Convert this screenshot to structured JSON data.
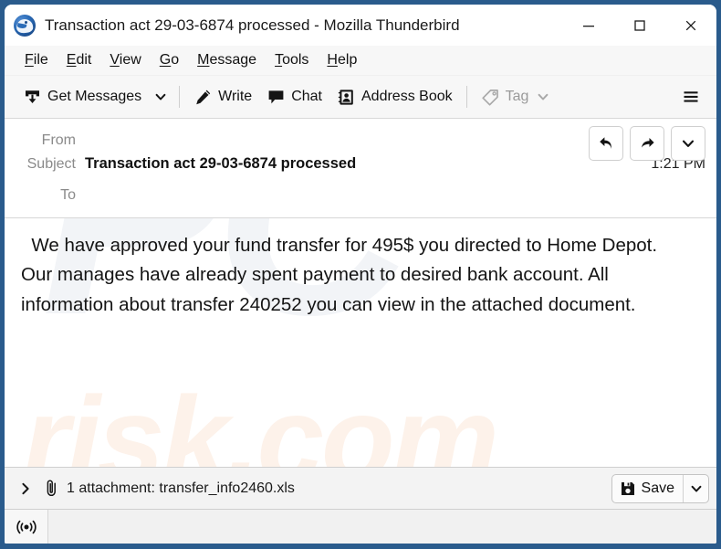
{
  "window": {
    "title": "Transaction act 29-03-6874 processed - Mozilla Thunderbird",
    "logo_icon": "thunderbird-logo",
    "controls": {
      "minimize": "minimize-icon",
      "maximize": "maximize-icon",
      "close": "close-icon"
    },
    "border_color": "#2a5b8c"
  },
  "menubar": {
    "items": [
      {
        "label": "File",
        "accesskey": "F"
      },
      {
        "label": "Edit",
        "accesskey": "E"
      },
      {
        "label": "View",
        "accesskey": "V"
      },
      {
        "label": "Go",
        "accesskey": "G"
      },
      {
        "label": "Message",
        "accesskey": "M"
      },
      {
        "label": "Tools",
        "accesskey": "T"
      },
      {
        "label": "Help",
        "accesskey": "H"
      }
    ]
  },
  "toolbar": {
    "get_messages_label": "Get Messages",
    "get_messages_icon": "download-inbox-icon",
    "get_messages_caret_icon": "chevron-down-icon",
    "write_label": "Write",
    "write_icon": "pencil-icon",
    "chat_label": "Chat",
    "chat_icon": "speech-bubble-icon",
    "address_book_label": "Address Book",
    "address_book_icon": "contact-card-icon",
    "tag_label": "Tag",
    "tag_icon": "tag-icon",
    "tag_caret_icon": "chevron-down-icon",
    "tag_disabled": true,
    "app_menu_icon": "hamburger-menu-icon"
  },
  "message_header": {
    "from_label": "From",
    "from_value": "",
    "subject_label": "Subject",
    "subject_value": "Transaction act 29-03-6874 processed",
    "to_label": "To",
    "to_value": "",
    "time": "1:21 PM",
    "actions": {
      "reply_icon": "reply-arrow-icon",
      "forward_icon": "forward-arrow-icon",
      "more_icon": "chevron-down-icon"
    }
  },
  "message_body": {
    "text": "  We have approved your fund transfer for 495$ you directed to Home Depot. Our manages have already spent payment to desired bank account. All information about transfer 240252 you can view in the attached document.",
    "watermark_big": "PC",
    "watermark_sub": "risk.com",
    "watermark_big_color": "#f2f4f7",
    "watermark_sub_color": "#fdf2ea"
  },
  "attachment_bar": {
    "expander_icon": "chevron-right-icon",
    "paperclip_icon": "paperclip-icon",
    "label": "1 attachment: transfer_info2460.xls",
    "save_label": "Save",
    "save_icon": "save-disk-icon",
    "save_caret_icon": "chevron-down-icon"
  },
  "statusbar": {
    "signal_icon": "broadcast-signal-icon",
    "text": ""
  }
}
